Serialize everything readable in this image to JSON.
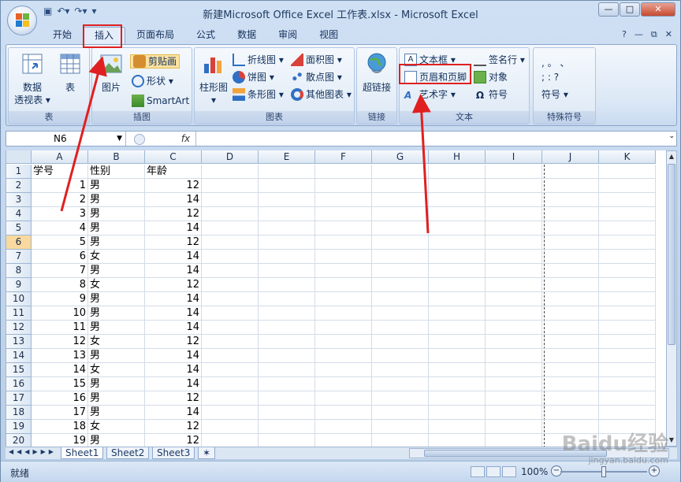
{
  "window": {
    "title": "新建Microsoft Office Excel 工作表.xlsx - Microsoft Excel",
    "controls": [
      "—",
      "□",
      "✕"
    ]
  },
  "ribbon": {
    "tabs": [
      "开始",
      "插入",
      "页面布局",
      "公式",
      "数据",
      "审阅",
      "视图"
    ],
    "active_tab": "插入",
    "groups": {
      "table": {
        "label": "表",
        "pivot_label": "数据\n透视表",
        "pivot_line1": "数据",
        "pivot_line2": "透视表 ▾",
        "table_label": "表"
      },
      "illustrations": {
        "label": "插图",
        "picture": "图片",
        "clipart": "剪贴画",
        "shapes": "形状 ▾",
        "smartart": "SmartArt"
      },
      "charts": {
        "label": "图表",
        "column_line1": "柱形图",
        "column_line2": "▾",
        "line": "折线图 ▾",
        "pie": "饼图 ▾",
        "bar": "条形图 ▾",
        "area": "面积图 ▾",
        "scatter": "散点图 ▾",
        "other": "其他图表 ▾"
      },
      "links": {
        "label": "链接",
        "hyperlink": "超链接"
      },
      "text": {
        "label": "文本",
        "textbox": "文本框 ▾",
        "header_footer": "页眉和页脚",
        "wordart": "艺术字 ▾",
        "signature": "签名行 ▾",
        "object": "对象",
        "symbol": "符号"
      },
      "special": {
        "label": "特殊符号",
        "row1": ",  。  、",
        "row2": ";  :  ?",
        "symbol": "符号 ▾"
      }
    }
  },
  "formula_bar": {
    "name_box": "N6",
    "fx": "fx",
    "value": ""
  },
  "sheet": {
    "columns": [
      "A",
      "B",
      "C",
      "D",
      "E",
      "F",
      "G",
      "H",
      "I",
      "J",
      "K"
    ],
    "rows": [
      [
        "学号",
        "性别",
        "年龄"
      ],
      [
        "1",
        "男",
        "12"
      ],
      [
        "2",
        "男",
        "14"
      ],
      [
        "3",
        "男",
        "12"
      ],
      [
        "4",
        "男",
        "14"
      ],
      [
        "5",
        "男",
        "12"
      ],
      [
        "6",
        "女",
        "14"
      ],
      [
        "7",
        "男",
        "14"
      ],
      [
        "8",
        "女",
        "12"
      ],
      [
        "9",
        "男",
        "14"
      ],
      [
        "10",
        "男",
        "14"
      ],
      [
        "11",
        "男",
        "14"
      ],
      [
        "12",
        "女",
        "12"
      ],
      [
        "13",
        "男",
        "14"
      ],
      [
        "14",
        "女",
        "14"
      ],
      [
        "15",
        "男",
        "14"
      ],
      [
        "16",
        "男",
        "12"
      ],
      [
        "17",
        "男",
        "14"
      ],
      [
        "18",
        "女",
        "12"
      ],
      [
        "19",
        "男",
        "12"
      ]
    ],
    "row_numbers": [
      "1",
      "2",
      "3",
      "4",
      "5",
      "6",
      "7",
      "8",
      "9",
      "10",
      "11",
      "12",
      "13",
      "14",
      "15",
      "16",
      "17",
      "18",
      "19",
      "20"
    ],
    "selected_row": "6",
    "tabs": [
      "Sheet1",
      "Sheet2",
      "Sheet3"
    ],
    "active_tab": "Sheet1"
  },
  "status": {
    "text": "就绪",
    "zoom": "100%"
  },
  "watermark": {
    "brand": "Baidu经验",
    "url": "jingyan.baidu.com"
  },
  "colors": {
    "annotation_red": "#e02020",
    "ribbon_blue": "#dce8f6"
  }
}
